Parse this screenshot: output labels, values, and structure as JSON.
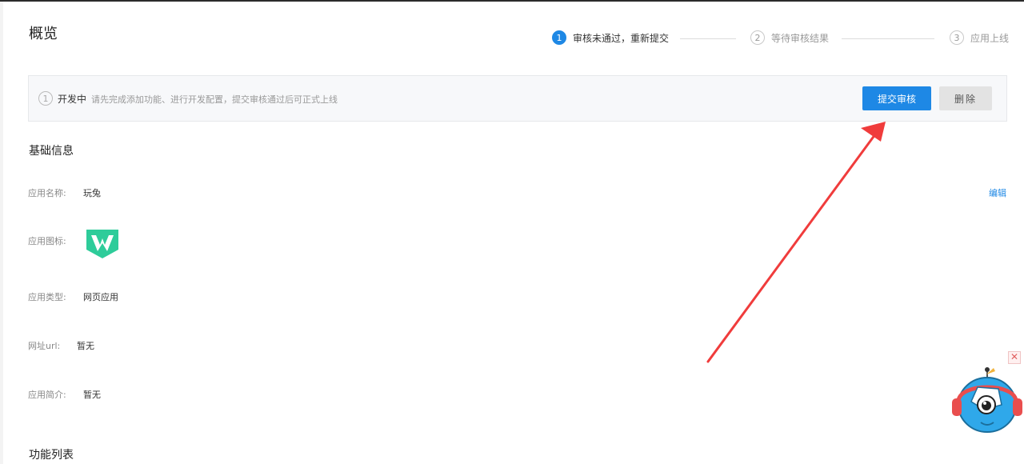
{
  "page": {
    "title": "概览"
  },
  "steps": [
    {
      "num": "1",
      "label": "审核未通过，重新提交",
      "state": "active"
    },
    {
      "num": "2",
      "label": "等待审核结果",
      "state": "pending"
    },
    {
      "num": "3",
      "label": "应用上线",
      "state": "pending"
    }
  ],
  "notice": {
    "icon_text": "1",
    "status": "开发中",
    "description": "请先完成添加功能、进行开发配置，提交审核通过后可正式上线",
    "submit_label": "提交审核",
    "delete_label": "删除"
  },
  "basic_info": {
    "title": "基础信息",
    "edit_label": "编辑",
    "app_name_label": "应用名称:",
    "app_name_value": "玩兔",
    "app_icon_label": "应用图标:",
    "app_type_label": "应用类型:",
    "app_type_value": "网页应用",
    "url_label": "网址url:",
    "url_value": "暂无",
    "intro_label": "应用简介:",
    "intro_value": "暂无"
  },
  "features": {
    "title": "功能列表"
  },
  "widget": {
    "close_label": "✕"
  },
  "colors": {
    "primary": "#1e88e5",
    "icon_green": "#2ecc9a",
    "arrow": "#f03c3c",
    "mascot_blue": "#2fa8ea"
  },
  "icons": [
    "info-icon",
    "app-logo-icon",
    "close-icon",
    "mascot-icon",
    "annotation-arrow"
  ]
}
